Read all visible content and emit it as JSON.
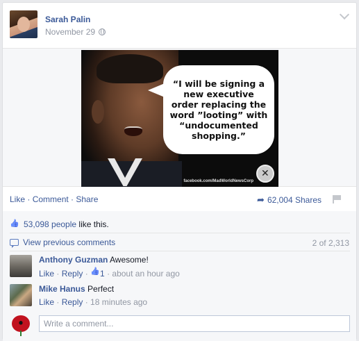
{
  "post": {
    "author": "Sarah Palin",
    "date": "November 29",
    "privacy_icon": "globe-icon",
    "menu_icon": "chevron-down-icon"
  },
  "meme": {
    "quote": "“I will be signing a new executive order replacing the word ”looting” with “undocumented shopping.”",
    "watermark": "facebook.com/MadWorldNewsCorp"
  },
  "actions": {
    "like": "Like",
    "comment": "Comment",
    "share": "Share",
    "sep": " · ",
    "shares": "62,004 Shares"
  },
  "likes": {
    "people": "53,098 people",
    "suffix": "like this."
  },
  "view_previous": {
    "label": "View previous comments",
    "count": "2 of 2,313"
  },
  "comments": [
    {
      "name": "Anthony Guzman",
      "text": "Awesome!",
      "like": "Like",
      "reply": "Reply",
      "like_count": "1",
      "time": "about an hour ago"
    },
    {
      "name": "Mike Hanus",
      "text": "Perfect",
      "like": "Like",
      "reply": "Reply",
      "time": "18 minutes ago"
    }
  ],
  "composer": {
    "placeholder": "Write a comment..."
  },
  "colors": {
    "link": "#3b5998",
    "muted": "#9197a3",
    "ufi_bg": "#f6f7f9"
  }
}
